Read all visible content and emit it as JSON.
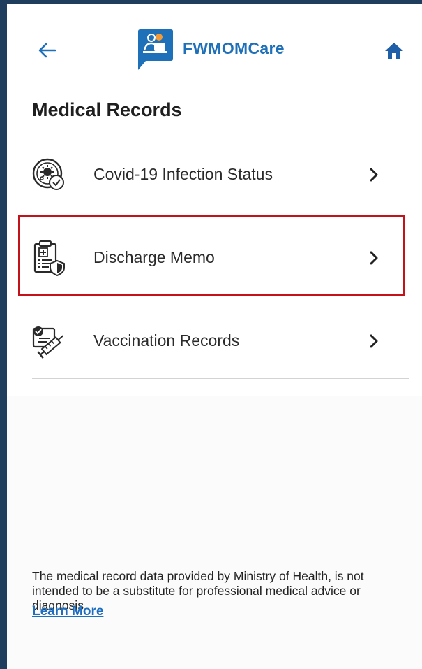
{
  "header": {
    "app_name": "FWMOMCare",
    "back_icon": "arrow-left-icon",
    "home_icon": "home-icon",
    "logo_icon": "fwmomcare-logo-icon",
    "brand_color": "#1e70b8"
  },
  "page": {
    "title": "Medical Records"
  },
  "records": [
    {
      "label": "Covid-19 Infection Status",
      "icon": "virus-shield-icon"
    },
    {
      "label": "Discharge Memo",
      "icon": "clipboard-medical-icon",
      "highlighted": true
    },
    {
      "label": "Vaccination Records",
      "icon": "vaccine-syringe-icon"
    }
  ],
  "footer": {
    "disclaimer": "The medical record data provided by Ministry of Health, is not intended to be a substitute for professional medical advice or diagnosis.",
    "learn_more": "Learn More"
  },
  "colors": {
    "highlight_border": "#c4121b",
    "link": "#1e6ec0",
    "frame": "#1f3d5c"
  }
}
